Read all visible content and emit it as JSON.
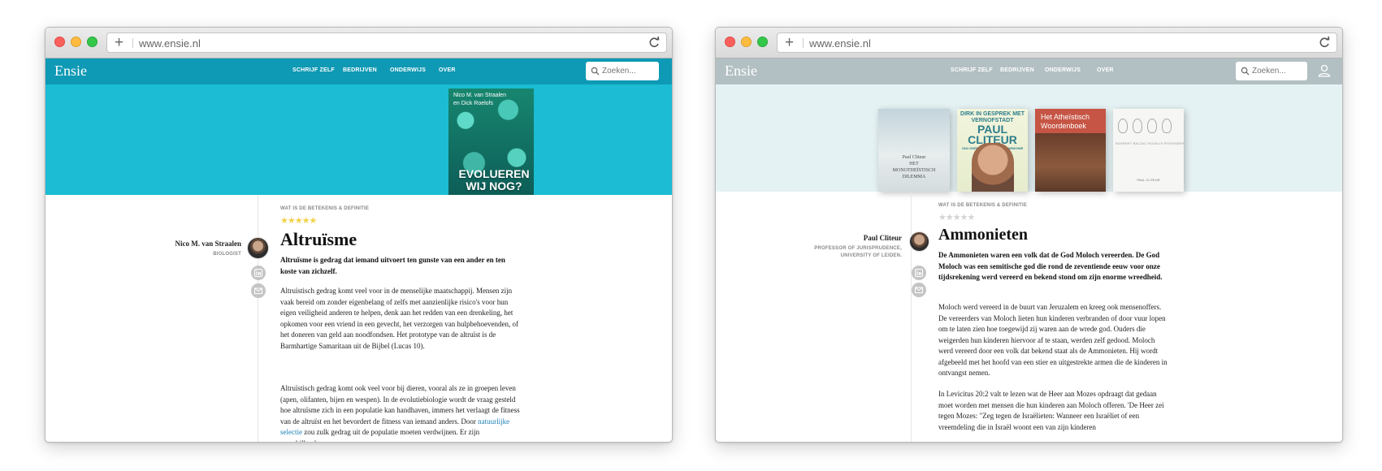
{
  "left_window": {
    "url": "www.ensie.nl",
    "logo": "Ensie",
    "nav": [
      "SCHRIJF ZELF",
      "BEDRIJVEN",
      "ONDERWIJS",
      "OVER"
    ],
    "search_placeholder": "Zoeken...",
    "hero_book": {
      "author_line1": "Nico M. van Straalen",
      "author_line2": "en Dick Roelofs",
      "title_line1": "EVOLUEREN",
      "title_line2": "WIJ NOG?"
    },
    "category": "WAT IS DE BETEKENIS & DEFINITIE",
    "rating": "★★★★★",
    "author_name": "Nico M. van Straalen",
    "author_role": "BIOLOGIST",
    "title": "Altruïsme",
    "lead": "Altruïsme is gedrag dat iemand uitvoert ten gunste van een ander en ten koste van zichzelf.",
    "para1": "Altruïstisch gedrag komt veel voor in de menselijke maatschappij. Mensen zijn vaak bereid om zonder eigenbelang of zelfs met aanzienlijke risico's voor hun eigen veiligheid anderen te helpen, denk aan het redden van een drenkeling, het opkomen voor een vriend in een gevecht, het verzorgen van hulpbehoevenden, of het doneren van geld aan noodfondsen. Het prototype van de altruïst is de Barmhartige Samaritaan uit de Bijbel (Lucas 10).",
    "para2_before": "Altruïstisch gedrag komt ook veel voor bij dieren, vooral als ze in groepen leven (apen, olifanten, bijen en wespen). In de evolutiebiologie wordt de vraag gesteld hoe altruïsme zich in een populatie kan handhaven, immers het verlaagt de fitness van de altruïst en het bevordert de fitness van iemand anders. Door ",
    "para2_link": "natuurlijke selectie",
    "para2_after": " zou zulk gedrag uit de populatie moeten verdwijnen. Er zijn verschillende"
  },
  "right_window": {
    "url": "www.ensie.nl",
    "logo": "Ensie",
    "nav": [
      "SCHRIJF ZELF",
      "BEDRIJVEN",
      "ONDERWIJS",
      "OVER"
    ],
    "search_placeholder": "Zoeken...",
    "books": {
      "b1": "Paul Cliteur\nHET\nMONOTHEÏSTISCH\nDILEMMA",
      "b2_top": "DIRK IN GESPREK MET",
      "b2_mid": "VERNOFSTADT",
      "b2_big": "PAUL CLITEUR",
      "b2_sub": "VAN ONREDENHEID, NAAR HARMONIE",
      "b3": "Het Atheïstisch Woordenboek",
      "b4_mid": "BARBERT·BALZAC·NOVALIS·RODENBERG",
      "b4_bot": "PAUL CLITEUR"
    },
    "category": "WAT IS DE BETEKENIS & DEFINITIE",
    "rating": "★★★★★",
    "author_name": "Paul Cliteur",
    "author_role": "PROFESSOR OF JURISPRUDENCE,\nUNIVERSITY OF LEIDEN.",
    "title": "Ammonieten",
    "lead": "De Ammonieten waren een volk dat de God Moloch vereerden. De God Moloch was een semitische god die rond de zeventiende eeuw voor onze tijdsrekening werd vereerd en bekend stond om zijn enorme wreedheid.",
    "para1": "Moloch werd vereerd in de buurt van Jeruzalem en kreeg ook mensenoffers. De vereerders van Moloch lieten hun kinderen verbranden of door vuur lopen om te laten zien hoe toegewijd zij waren aan de wrede god. Ouders die weigerden hun kinderen hiervoor af te staan, werden zelf gedood. Moloch werd vereerd door een volk dat bekend staat als de Ammonieten. Hij wordt afgebeeld met het hoofd van een stier en uitgestrekte armen die de kinderen in ontvangst nemen.",
    "para2": "In Levicitus 20:2 valt te lezen wat de Heer aan Mozes opdraagt dat gedaan moet worden met mensen die hun kinderen aan Moloch offeren. 'De Heer zei tegen Mozes: \"Zeg tegen de Israëlieten: Wanneer een Israëliet of een vreemdeling die in Israël woont een van zijn kinderen"
  },
  "colors": {
    "teal_nav": "#0e99b4",
    "teal_hero": "#1bbcd4",
    "gray_nav": "#b3c0c3",
    "light_hero": "#e5f2f4",
    "link": "#1a7fb4",
    "star_gold": "#f2d14b"
  },
  "icons": [
    "plus-icon",
    "reload-icon",
    "search-icon",
    "user-icon",
    "linkedin-icon",
    "mail-icon"
  ]
}
